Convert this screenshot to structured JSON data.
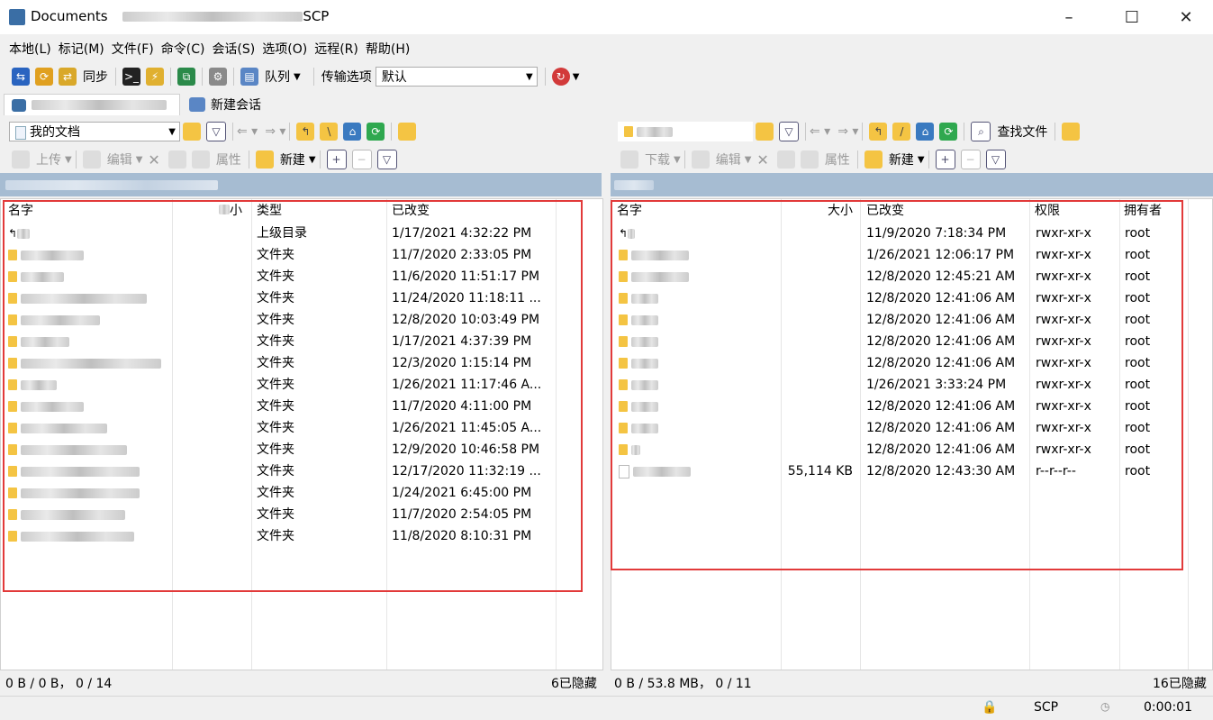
{
  "window": {
    "title": "Documents",
    "title_suffix": "SCP",
    "minimize": "–",
    "maximize": "☐",
    "close": "✕"
  },
  "menu": [
    "本地(L)",
    "标记(M)",
    "文件(F)",
    "命令(C)",
    "会话(S)",
    "选项(O)",
    "远程(R)",
    "帮助(H)"
  ],
  "toolbar1": {
    "sync": "同步",
    "queue": "队列",
    "transfer_label": "传输选项",
    "transfer_value": "默认"
  },
  "tabs": {
    "new_session": "新建会话"
  },
  "left": {
    "location": "我的文档",
    "actions": {
      "upload": "上传",
      "edit": "编辑",
      "properties": "属性",
      "new": "新建"
    },
    "columns": {
      "name": "名字",
      "size": "小",
      "type": "类型",
      "changed": "已改变"
    },
    "rows": [
      {
        "type": "上级目录",
        "changed": "1/17/2021  4:32:22 PM"
      },
      {
        "type": "文件夹",
        "changed": "11/7/2020  2:33:05 PM"
      },
      {
        "type": "文件夹",
        "changed": "11/6/2020  11:51:17 PM"
      },
      {
        "type": "文件夹",
        "changed": "11/24/2020  11:18:11 ..."
      },
      {
        "type": "文件夹",
        "changed": "12/8/2020  10:03:49 PM"
      },
      {
        "type": "文件夹",
        "changed": "1/17/2021  4:37:39 PM"
      },
      {
        "type": "文件夹",
        "changed": "12/3/2020  1:15:14 PM"
      },
      {
        "type": "文件夹",
        "changed": "1/26/2021  11:17:46 A..."
      },
      {
        "type": "文件夹",
        "changed": "11/7/2020  4:11:00 PM"
      },
      {
        "type": "文件夹",
        "changed": "1/26/2021  11:45:05 A..."
      },
      {
        "type": "文件夹",
        "changed": "12/9/2020  10:46:58 PM"
      },
      {
        "type": "文件夹",
        "changed": "12/17/2020  11:32:19 ..."
      },
      {
        "type": "文件夹",
        "changed": "1/24/2021  6:45:00 PM"
      },
      {
        "type": "文件夹",
        "changed": "11/7/2020  2:54:05 PM"
      },
      {
        "type": "文件夹",
        "changed": "11/8/2020  8:10:31 PM"
      }
    ],
    "status_left": "0 B / 0 B，  0 / 14",
    "status_right": "6已隐藏"
  },
  "right": {
    "actions": {
      "download": "下载",
      "edit": "编辑",
      "properties": "属性",
      "new": "新建",
      "find": "查找文件"
    },
    "columns": {
      "name": "名字",
      "size": "大小",
      "changed": "已改变",
      "rights": "权限",
      "owner": "拥有者"
    },
    "rows": [
      {
        "icon": "up",
        "size": "",
        "changed": "11/9/2020 7:18:34 PM",
        "rights": "rwxr-xr-x",
        "owner": "root"
      },
      {
        "icon": "folder",
        "size": "",
        "changed": "1/26/2021 12:06:17 PM",
        "rights": "rwxr-xr-x",
        "owner": "root"
      },
      {
        "icon": "folder",
        "size": "",
        "changed": "12/8/2020 12:45:21 AM",
        "rights": "rwxr-xr-x",
        "owner": "root"
      },
      {
        "icon": "folder",
        "size": "",
        "changed": "12/8/2020 12:41:06 AM",
        "rights": "rwxr-xr-x",
        "owner": "root"
      },
      {
        "icon": "folder",
        "size": "",
        "changed": "12/8/2020 12:41:06 AM",
        "rights": "rwxr-xr-x",
        "owner": "root"
      },
      {
        "icon": "folder",
        "size": "",
        "changed": "12/8/2020 12:41:06 AM",
        "rights": "rwxr-xr-x",
        "owner": "root"
      },
      {
        "icon": "folder",
        "size": "",
        "changed": "12/8/2020 12:41:06 AM",
        "rights": "rwxr-xr-x",
        "owner": "root"
      },
      {
        "icon": "folder",
        "size": "",
        "changed": "1/26/2021 3:33:24 PM",
        "rights": "rwxr-xr-x",
        "owner": "root"
      },
      {
        "icon": "folder",
        "size": "",
        "changed": "12/8/2020 12:41:06 AM",
        "rights": "rwxr-xr-x",
        "owner": "root"
      },
      {
        "icon": "folder",
        "size": "",
        "changed": "12/8/2020 12:41:06 AM",
        "rights": "rwxr-xr-x",
        "owner": "root"
      },
      {
        "icon": "folder",
        "size": "",
        "changed": "12/8/2020 12:41:06 AM",
        "rights": "rwxr-xr-x",
        "owner": "root"
      },
      {
        "icon": "file",
        "size": "55,114 KB",
        "changed": "12/8/2020 12:43:30 AM",
        "rights": "r--r--r--",
        "owner": "root"
      }
    ],
    "status_left": "0 B / 53.8 MB，  0 / 11",
    "status_right": "16已隐藏"
  },
  "statusbar": {
    "protocol": "SCP",
    "elapsed": "0:00:01"
  },
  "colors": {
    "highlight_box": "#e23a3a",
    "path_bar": "#a6bcd2",
    "folder": "#f4c443"
  }
}
